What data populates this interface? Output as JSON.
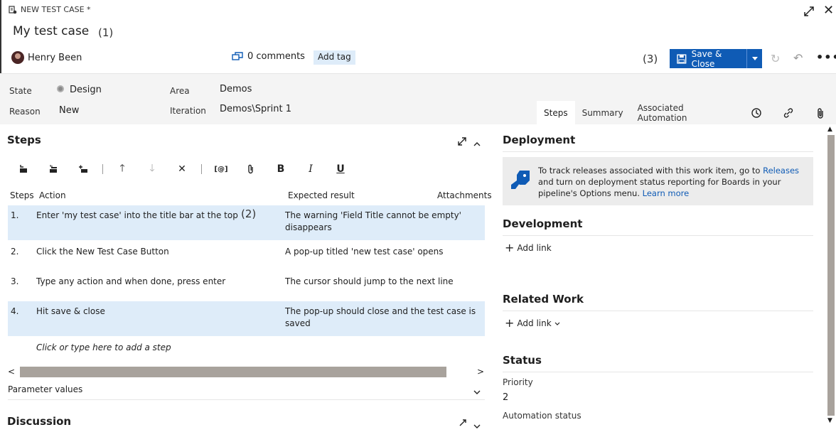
{
  "header": {
    "work_item_type": "NEW TEST CASE *",
    "title": "My test case",
    "annotation_1": "(1)",
    "annotation_3": "(3)",
    "user": "Henry Been",
    "comments": "0 comments",
    "add_tag": "Add tag",
    "save_close": "Save & Close"
  },
  "fields": {
    "state_label": "State",
    "state_value": "Design",
    "reason_label": "Reason",
    "reason_value": "New",
    "area_label": "Area",
    "area_value": "Demos",
    "iteration_label": "Iteration",
    "iteration_value": "Demos\\Sprint 1"
  },
  "tabs": [
    "Steps",
    "Summary",
    "Associated Automation"
  ],
  "steps": {
    "title": "Steps",
    "columns": [
      "Steps",
      "Action",
      "Expected result",
      "Attachments"
    ],
    "annotation_2": "(2)",
    "rows": [
      {
        "num": "1.",
        "action": "Enter 'my test case' into the title bar at the top",
        "expected": "The warning 'Field Title cannot be empty'",
        "expected2": "disappears"
      },
      {
        "num": "2.",
        "action": "Click the New Test Case Button",
        "expected": "A pop-up titled 'new test case' opens",
        "expected2": ""
      },
      {
        "num": "3.",
        "action": "Type any action and when done, press enter",
        "expected": "The cursor should jump to the next line",
        "expected2": ""
      },
      {
        "num": "4.",
        "action": "Hit save & close",
        "expected": "The pop-up should close and the test case is",
        "expected2": "saved"
      }
    ],
    "add_step": "Click or type here to add a step",
    "parameter_values": "Parameter values"
  },
  "discussion": {
    "title": "Discussion"
  },
  "deployment": {
    "title": "Deployment",
    "text_1": "To track releases associated with this work item, go to ",
    "link_releases": "Releases",
    "text_2": " and turn on deployment status reporting for Boards in your pipeline's Options menu. ",
    "link_learn": "Learn more"
  },
  "development": {
    "title": "Development",
    "add_link": "Add link"
  },
  "related_work": {
    "title": "Related Work",
    "add_link": "Add link"
  },
  "status": {
    "title": "Status",
    "priority_label": "Priority",
    "priority_value": "2",
    "automation_label": "Automation status"
  },
  "colors": {
    "accent": "#0f5bb5",
    "highlight": "#deecf9",
    "band": "#f4f4f4"
  }
}
